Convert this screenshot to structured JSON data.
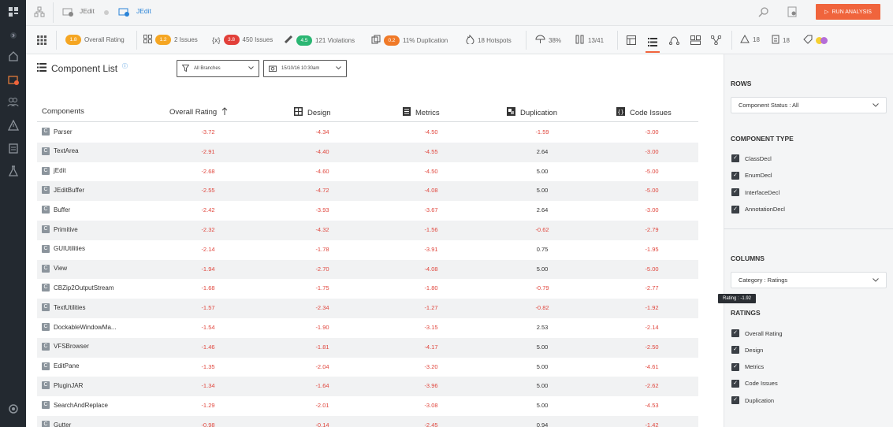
{
  "topbar": {
    "crumb_project": "JEdit",
    "crumb_active": "JEdit",
    "run_label": "RUN ANALYSIS"
  },
  "metrics": [
    {
      "badge": "1.8",
      "label": "Overall Rating",
      "color": "#f5a623"
    },
    {
      "badge": "1.2",
      "label": "2 Issues",
      "color": "#f5a623"
    },
    {
      "badge": "3.8",
      "label": "450 Issues",
      "color": "#e2403a"
    },
    {
      "badge": "4.5",
      "label": "121 Violations",
      "color": "#2bb673"
    },
    {
      "badge": "0.2",
      "label": "11% Duplication",
      "color": "#f07a28"
    },
    {
      "label": "18 Hotspots"
    },
    {
      "label": "38%"
    },
    {
      "label": "13/41"
    },
    {
      "label": "18"
    },
    {
      "label": "18"
    }
  ],
  "page": {
    "title": "Component List",
    "branch_filter": "All Branches",
    "date_filter": "15/10/16 10:30am"
  },
  "table": {
    "headers": [
      "Components",
      "Overall Rating",
      "Design",
      "Metrics",
      "Duplication",
      "Code Issues"
    ],
    "rows": [
      {
        "name": "Parser",
        "values": [
          "-3.72",
          "-4.34",
          "-4.50",
          "-1.59",
          "-3.00"
        ]
      },
      {
        "name": "TextArea",
        "values": [
          "-2.91",
          "-4.40",
          "-4.55",
          "2.64",
          "-3.00"
        ]
      },
      {
        "name": "jEdit",
        "values": [
          "-2.68",
          "-4.60",
          "-4.50",
          "5.00",
          "-5.00"
        ]
      },
      {
        "name": "JEditBuffer",
        "values": [
          "-2.55",
          "-4.72",
          "-4.08",
          "5.00",
          "-5.00"
        ]
      },
      {
        "name": "Buffer",
        "values": [
          "-2.42",
          "-3.93",
          "-3.67",
          "2.64",
          "-3.00"
        ]
      },
      {
        "name": "Primitive",
        "values": [
          "-2.32",
          "-4.32",
          "-1.56",
          "-0.62",
          "-2.79"
        ]
      },
      {
        "name": "GUIUtilities",
        "values": [
          "-2.14",
          "-1.78",
          "-3.91",
          "0.75",
          "-1.95"
        ]
      },
      {
        "name": "View",
        "values": [
          "-1.94",
          "-2.70",
          "-4.08",
          "5.00",
          "-5.00"
        ]
      },
      {
        "name": "CBZip2OutputStream",
        "values": [
          "-1.68",
          "-1.75",
          "-1.80",
          "-0.79",
          "-2.77"
        ]
      },
      {
        "name": "TextUtilities",
        "values": [
          "-1.57",
          "-2.34",
          "-1.27",
          "-0.82",
          "-1.92"
        ]
      },
      {
        "name": "DockableWindowMa...",
        "values": [
          "-1.54",
          "-1.90",
          "-3.15",
          "2.53",
          "-2.14"
        ]
      },
      {
        "name": "VFSBrowser",
        "values": [
          "-1.46",
          "-1.81",
          "-4.17",
          "5.00",
          "-2.50"
        ]
      },
      {
        "name": "EditPane",
        "values": [
          "-1.35",
          "-2.04",
          "-3.20",
          "5.00",
          "-4.61"
        ]
      },
      {
        "name": "PluginJAR",
        "values": [
          "-1.34",
          "-1.64",
          "-3.96",
          "5.00",
          "-2.62"
        ]
      },
      {
        "name": "SearchAndReplace",
        "values": [
          "-1.29",
          "-2.01",
          "-3.08",
          "5.00",
          "-4.53"
        ]
      },
      {
        "name": "Gutter",
        "values": [
          "-0.98",
          "-0.14",
          "-2.45",
          "0.94",
          "-1.42"
        ]
      }
    ]
  },
  "panel": {
    "rows_title": "ROWS",
    "rows_select": "Component Status : All",
    "type_title": "COMPONENT TYPE",
    "types": [
      "ClassDecl",
      "EnumDecl",
      "InterfaceDecl",
      "AnnotationDecl"
    ],
    "columns_title": "COLUMNS",
    "columns_select": "Category : Ratings",
    "tooltip": "Rating : -1.92",
    "ratings_title": "RATINGS",
    "ratings": [
      "Overall Rating",
      "Design",
      "Metrics",
      "Code Issues",
      "Duplication"
    ]
  },
  "colors": {
    "accent": "#f0643c",
    "negative": "#e0463d",
    "link": "#2a84d8"
  }
}
